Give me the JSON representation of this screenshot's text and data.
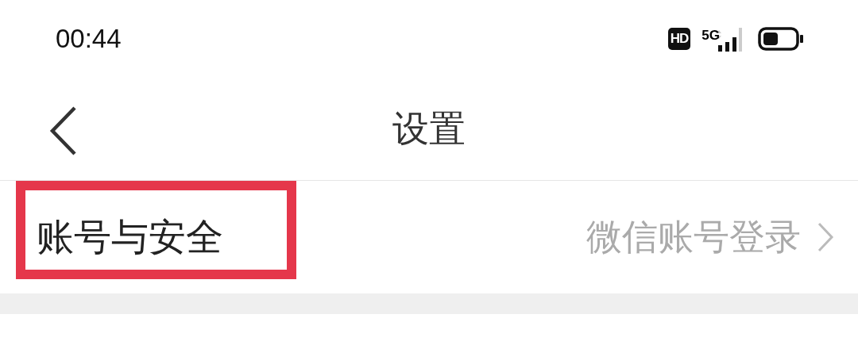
{
  "status_bar": {
    "time": "00:44",
    "hd_badge": "HD",
    "network": "5G"
  },
  "nav_bar": {
    "title": "设置"
  },
  "settings_rows": [
    {
      "label": "账号与安全",
      "value": "微信账号登录",
      "highlighted": true
    }
  ]
}
